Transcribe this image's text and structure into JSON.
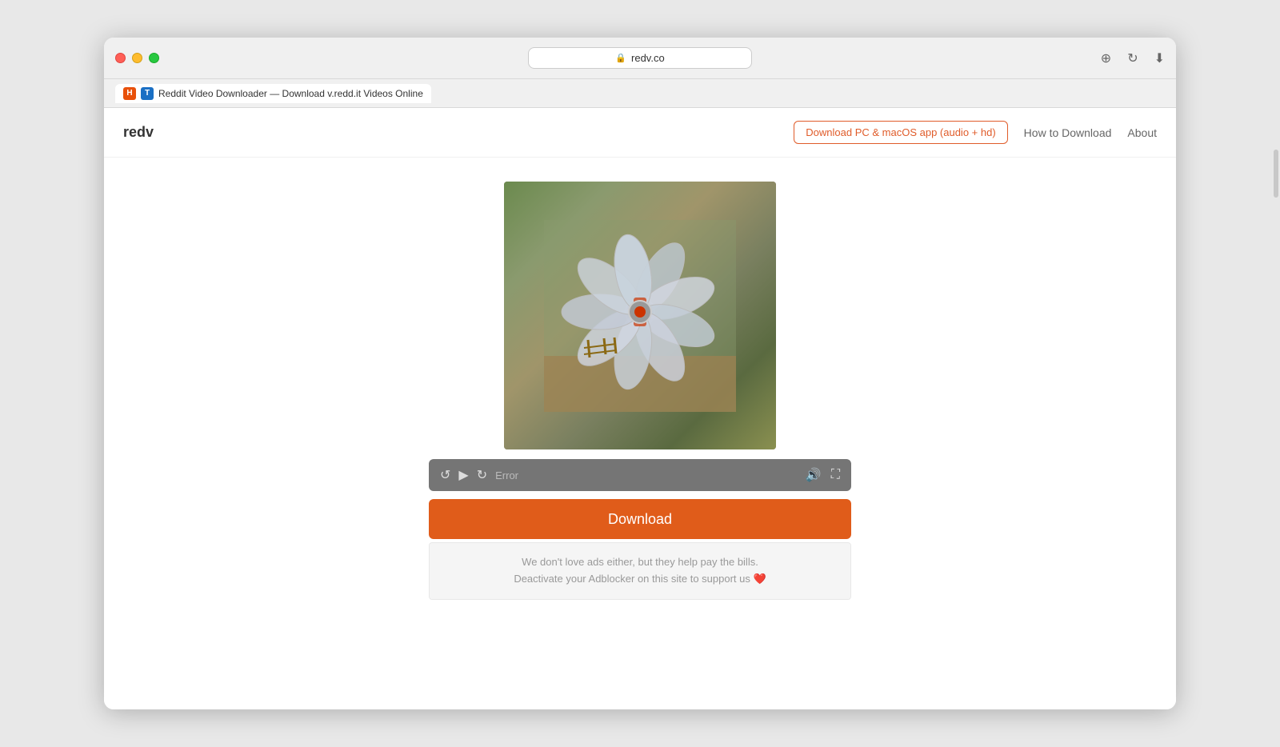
{
  "browser": {
    "url": "redv.co",
    "tab_title": "Reddit Video Downloader — Download v.redd.it Videos Online",
    "tab_favicon_1": "H",
    "tab_favicon_2": "T"
  },
  "nav": {
    "logo": "redv",
    "app_button_label": "Download PC & macOS app (audio + hd)",
    "how_to_label": "How to Download",
    "about_label": "About"
  },
  "video": {
    "error_text": "Error"
  },
  "download_button": {
    "label": "Download"
  },
  "ad_notice": {
    "line1": "We don't love ads either, but they help pay the bills.",
    "line2": "Deactivate your Adblocker on this site to support us ❤️"
  }
}
